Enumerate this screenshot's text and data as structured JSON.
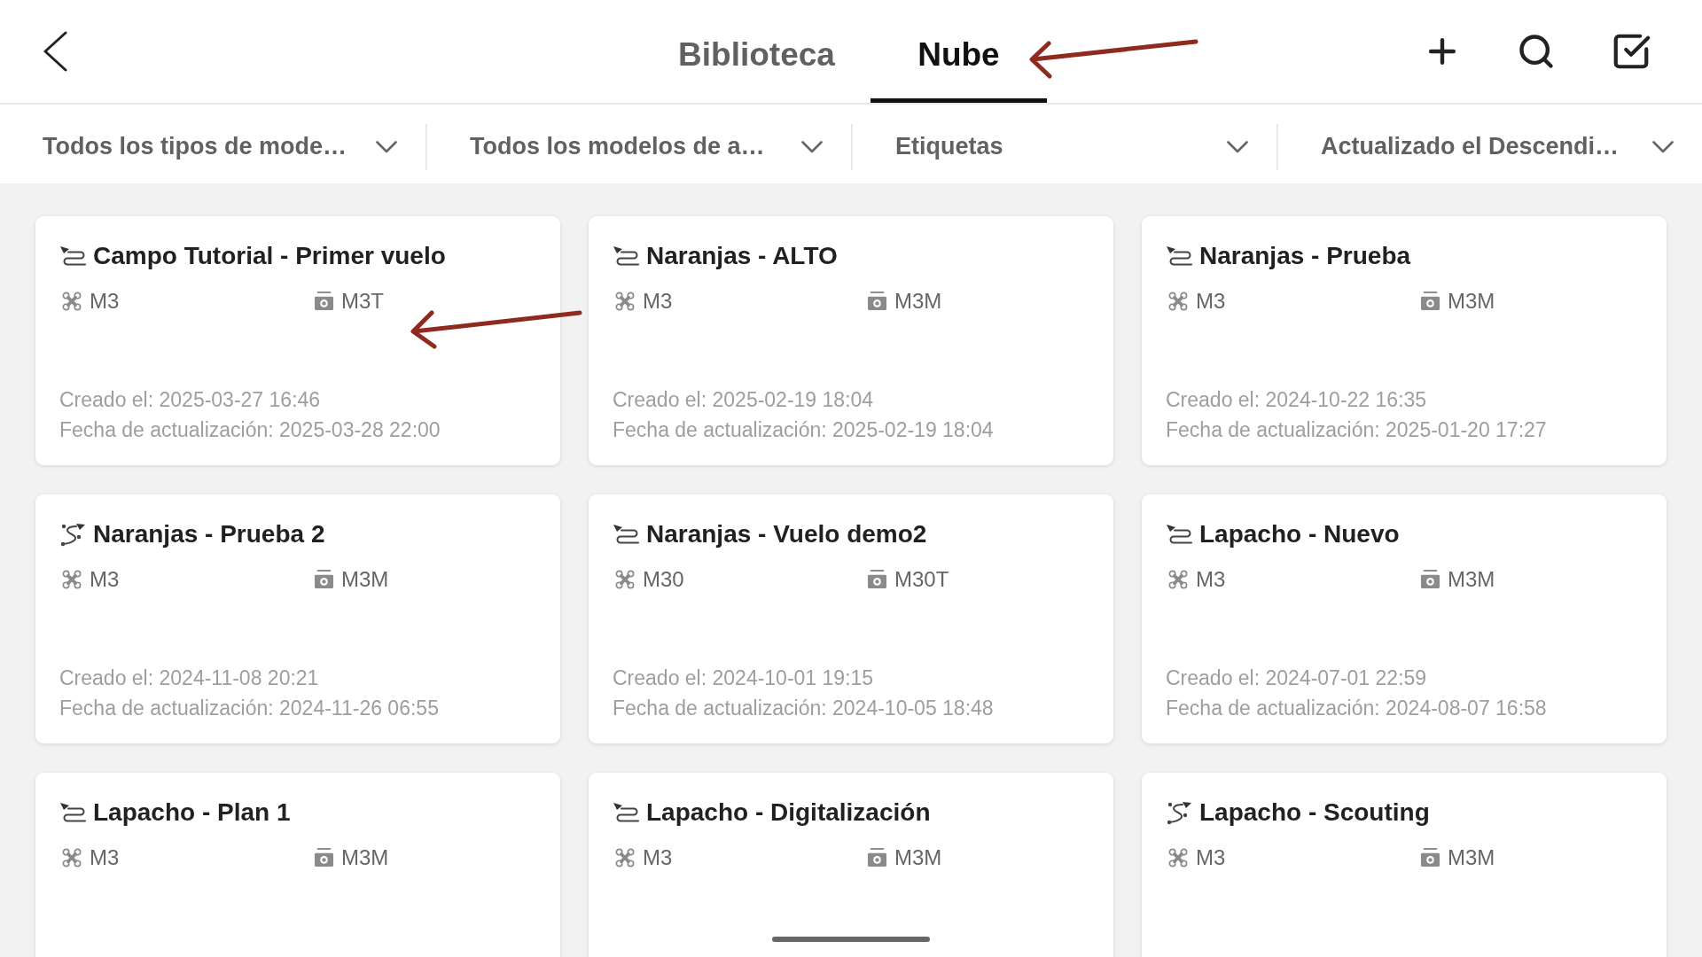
{
  "header": {
    "tabs": [
      {
        "label": "Biblioteca",
        "selected": false
      },
      {
        "label": "Nube",
        "selected": true
      }
    ]
  },
  "filters": [
    {
      "label": "Todos los tipos de mode…"
    },
    {
      "label": "Todos los modelos de a…"
    },
    {
      "label": "Etiquetas"
    },
    {
      "label": "Actualizado el Descendi…"
    }
  ],
  "missions": [
    {
      "kind": "area",
      "title": "Campo Tutorial - Primer vuelo",
      "aircraft": "M3",
      "camera": "M3T",
      "created": "Creado el: 2025-03-27 16:46",
      "updated": "Fecha de actualización: 2025-03-28 22:00"
    },
    {
      "kind": "area",
      "title": "Naranjas - ALTO",
      "aircraft": "M3",
      "camera": "M3M",
      "created": "Creado el: 2025-02-19 18:04",
      "updated": "Fecha de actualización: 2025-02-19 18:04"
    },
    {
      "kind": "area",
      "title": "Naranjas - Prueba",
      "aircraft": "M3",
      "camera": "M3M",
      "created": "Creado el: 2024-10-22 16:35",
      "updated": "Fecha de actualización: 2025-01-20 17:27"
    },
    {
      "kind": "curve",
      "title": "Naranjas - Prueba 2",
      "aircraft": "M3",
      "camera": "M3M",
      "created": "Creado el: 2024-11-08 20:21",
      "updated": "Fecha de actualización: 2024-11-26 06:55"
    },
    {
      "kind": "area",
      "title": "Naranjas - Vuelo demo2",
      "aircraft": "M30",
      "camera": "M30T",
      "created": "Creado el: 2024-10-01 19:15",
      "updated": "Fecha de actualización: 2024-10-05 18:48"
    },
    {
      "kind": "area",
      "title": "Lapacho - Nuevo",
      "aircraft": "M3",
      "camera": "M3M",
      "created": "Creado el: 2024-07-01 22:59",
      "updated": "Fecha de actualización: 2024-08-07 16:58"
    },
    {
      "kind": "area",
      "title": "Lapacho - Plan 1",
      "aircraft": "M3",
      "camera": "M3M"
    },
    {
      "kind": "area",
      "title": "Lapacho - Digitalización",
      "aircraft": "M3",
      "camera": "M3M"
    },
    {
      "kind": "curve",
      "title": "Lapacho - Scouting",
      "aircraft": "M3",
      "camera": "M3M"
    }
  ]
}
